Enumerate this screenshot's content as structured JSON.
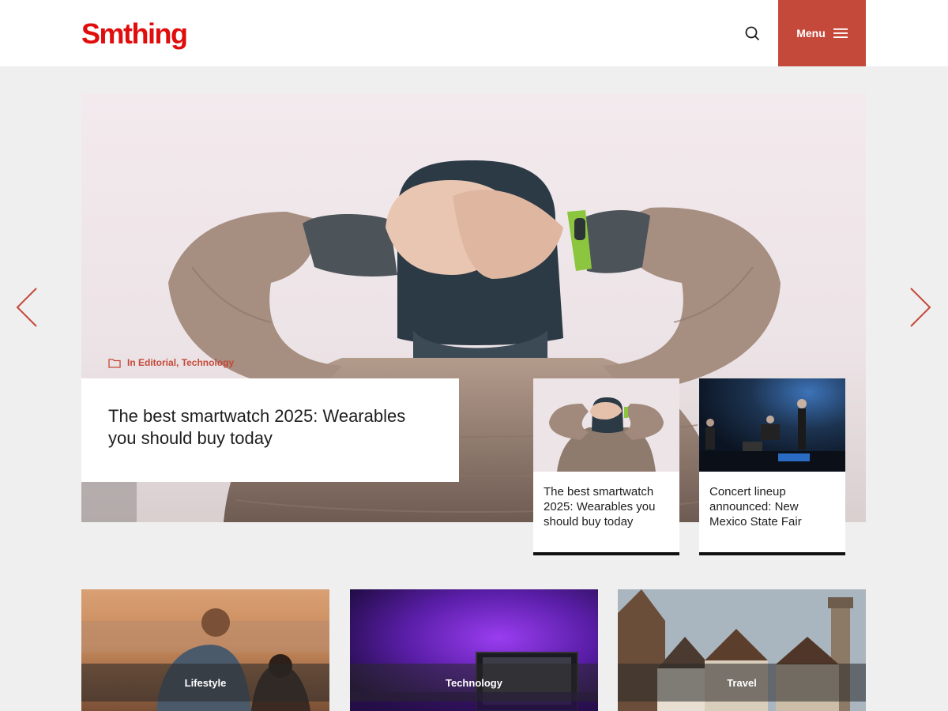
{
  "header": {
    "logo": "Smthing",
    "menu_label": "Menu"
  },
  "hero": {
    "categories_prefix": "In",
    "categories": "Editorial, Technology",
    "title": "The best smartwatch 2025: Wearables you should buy today"
  },
  "slider_cards": [
    {
      "title": "The best smartwatch 2025: Wearables you should buy today"
    },
    {
      "title": "Concert lineup announced: New Mexico State Fair"
    }
  ],
  "category_tiles": [
    {
      "label": "Lifestyle"
    },
    {
      "label": "Technology"
    },
    {
      "label": "Travel"
    }
  ],
  "colors": {
    "accent": "#c5493a",
    "logo": "#e00d0d",
    "background": "#efefef"
  },
  "icons": {
    "search": "search-icon",
    "menu": "hamburger-icon",
    "prev": "chevron-left-icon",
    "next": "chevron-right-icon",
    "folder": "folder-icon"
  }
}
